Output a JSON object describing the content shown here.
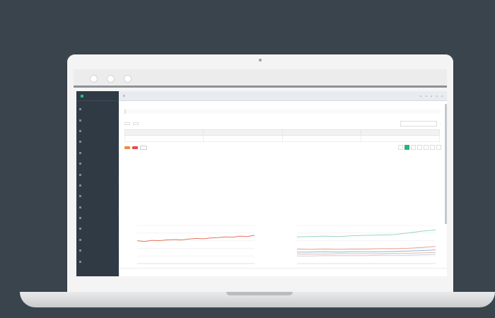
{
  "app": {
    "brand": "",
    "top_links": [
      "",
      "",
      "",
      "",
      ""
    ],
    "nav_items": [
      "",
      "",
      "",
      "",
      "",
      "",
      "",
      "",
      "",
      "",
      "",
      "",
      "",
      "",
      ""
    ],
    "side_footer": ""
  },
  "page": {
    "title": "",
    "description": "",
    "notes": [
      "",
      "",
      "",
      "",
      ""
    ],
    "tip": ""
  },
  "toolbar": {
    "btn_a": "",
    "btn_b": "",
    "search_placeholder": ""
  },
  "table": {
    "headers": [
      "",
      "",
      "",
      ""
    ],
    "rows": [
      [
        "",
        "",
        "",
        ""
      ]
    ]
  },
  "actions": {
    "orange": "",
    "red": "",
    "plain": ""
  },
  "pager": [
    "",
    "",
    "",
    "",
    "",
    "",
    ""
  ],
  "footer": {
    "left": "",
    "right": ""
  },
  "colors": {
    "sidebar": "#2f3a44",
    "accent": "#2bb37b",
    "orange": "#f08a3c",
    "red": "#e54b4b"
  },
  "chart_data": [
    {
      "type": "line",
      "series": [
        {
          "values": [
            60,
            58,
            61,
            60,
            62,
            63,
            62,
            64,
            66,
            65,
            67,
            68,
            70,
            69,
            72,
            71,
            74
          ]
        }
      ],
      "ylim": [
        0,
        100
      ],
      "grid": true
    },
    {
      "type": "line",
      "series": [
        {
          "values": [
            70,
            71,
            72,
            71,
            73,
            74,
            75,
            76,
            80,
            85,
            88
          ]
        },
        {
          "values": [
            38,
            37,
            38,
            37,
            38,
            38,
            39,
            39,
            40,
            42,
            45
          ]
        },
        {
          "values": [
            30,
            30,
            31,
            30,
            31,
            31,
            31,
            32,
            33,
            34,
            36
          ]
        },
        {
          "values": [
            25,
            25,
            25,
            26,
            26,
            26,
            26,
            27,
            27,
            28,
            29
          ]
        },
        {
          "values": [
            20,
            20,
            21,
            21,
            21,
            21,
            22,
            22,
            22,
            23,
            24
          ]
        }
      ],
      "series_colors": [
        "#9bd4c4",
        "#f0a08a",
        "#8fb8d8",
        "#e6b8b0",
        "#c8d2da"
      ],
      "ylim": [
        0,
        100
      ],
      "grid": true
    }
  ]
}
